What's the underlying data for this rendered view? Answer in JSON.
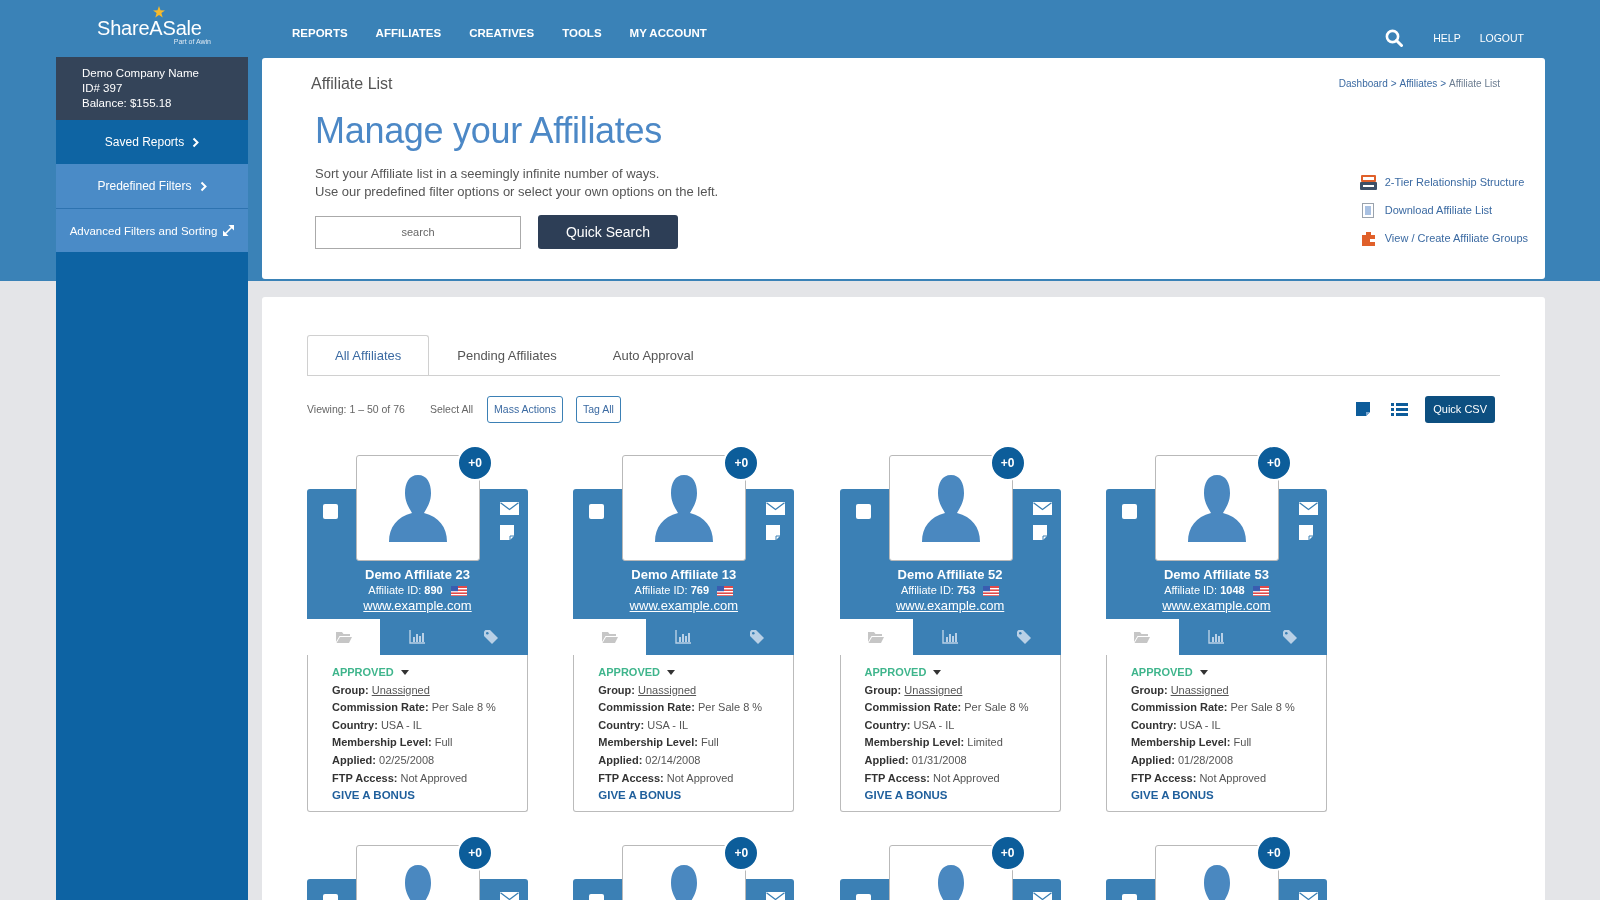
{
  "header": {
    "logo": {
      "name": "ShareASale",
      "tagline": "Part of Awin"
    },
    "nav": [
      {
        "label": "REPORTS"
      },
      {
        "label": "AFFILIATES"
      },
      {
        "label": "CREATIVES"
      },
      {
        "label": "TOOLS"
      },
      {
        "label": "MY ACCOUNT"
      }
    ],
    "links": [
      {
        "label": "HELP"
      },
      {
        "label": "LOGOUT"
      }
    ]
  },
  "sidebar": {
    "account": {
      "company": "Demo Company Name",
      "id": "ID# 397",
      "balance": "Balance: $155.18"
    },
    "items": [
      {
        "label": "Saved Reports",
        "kind": "report"
      },
      {
        "label": "Predefined Filters",
        "kind": "filter"
      },
      {
        "label": "Advanced Filters and Sorting",
        "kind": "advanced"
      }
    ]
  },
  "intro": {
    "title": "Affiliate List",
    "breadcrumb": [
      {
        "label": "Dashboard",
        "kind": "link"
      },
      {
        "label": ">",
        "kind": "separator"
      },
      {
        "label": "Affiliates",
        "kind": "link"
      },
      {
        "label": ">",
        "kind": "separator"
      },
      {
        "label": "Affiliate List",
        "kind": "current"
      }
    ],
    "heading": "Manage your Affiliates",
    "description": [
      "Sort your Affiliate list in a seemingly infinite number of ways.",
      "Use our predefined filter options or select your own options on the left."
    ],
    "search": {
      "placeholder": "search"
    },
    "search_button": "Quick Search",
    "quick_links": [
      {
        "label": "2-Tier Relationship Structure",
        "kind": "tray"
      },
      {
        "label": "Download Affiliate List",
        "kind": "document"
      },
      {
        "label": "View / Create Affiliate Groups",
        "kind": "puzzle"
      }
    ]
  },
  "affiliates": {
    "tabs": [
      {
        "label": "All Affiliates",
        "selected": true
      },
      {
        "label": "Pending Affiliates",
        "selected": false
      },
      {
        "label": "Auto Approval",
        "selected": false
      }
    ],
    "toolbar": {
      "viewing": "Viewing: 1 – 50 of 76",
      "select_all": "Select All",
      "buttons": [
        {
          "label": "Mass Actions"
        },
        {
          "label": "Tag All"
        }
      ],
      "views": [
        {
          "kind": "tiles"
        },
        {
          "kind": "list"
        }
      ],
      "csv_button": "Quick CSV"
    },
    "cards": [
      {
        "badge": "+0",
        "checked": false,
        "name": "Demo Affiliate 23",
        "id": "Affiliate ID: **890**",
        "website": "www.example.com",
        "tabs": [
          {
            "kind": "folder",
            "selected": true
          },
          {
            "kind": "chart",
            "selected": false
          },
          {
            "kind": "tag",
            "selected": false
          }
        ],
        "status": "APPROVED",
        "details": [
          {
            "label": "Group:",
            "value": "Unassigned",
            "kind": "link"
          },
          {
            "label": "Commission Rate:",
            "value": "Per Sale 8 %",
            "kind": "text"
          },
          {
            "label": "Country:",
            "value": "USA - IL",
            "kind": "text"
          },
          {
            "label": "Membership Level:",
            "value": "Full",
            "kind": "text"
          },
          {
            "label": "Applied:",
            "value": "02/25/2008",
            "kind": "text"
          },
          {
            "label": "FTP Access:",
            "value": "Not Approved",
            "kind": "text"
          }
        ],
        "bonus_link": "GIVE A BONUS"
      },
      {
        "badge": "+0",
        "checked": false,
        "name": "Demo Affiliate 13",
        "id": "Affiliate ID: **769**",
        "website": "www.example.com",
        "tabs": [
          {
            "kind": "folder",
            "selected": true
          },
          {
            "kind": "chart",
            "selected": false
          },
          {
            "kind": "tag",
            "selected": false
          }
        ],
        "status": "APPROVED",
        "details": [
          {
            "label": "Group:",
            "value": "Unassigned",
            "kind": "link"
          },
          {
            "label": "Commission Rate:",
            "value": "Per Sale 8 %",
            "kind": "text"
          },
          {
            "label": "Country:",
            "value": "USA - IL",
            "kind": "text"
          },
          {
            "label": "Membership Level:",
            "value": "Full",
            "kind": "text"
          },
          {
            "label": "Applied:",
            "value": "02/14/2008",
            "kind": "text"
          },
          {
            "label": "FTP Access:",
            "value": "Not Approved",
            "kind": "text"
          }
        ],
        "bonus_link": "GIVE A BONUS"
      },
      {
        "badge": "+0",
        "checked": false,
        "name": "Demo Affiliate 52",
        "id": "Affiliate ID: **753**",
        "website": "www.example.com",
        "tabs": [
          {
            "kind": "folder",
            "selected": true
          },
          {
            "kind": "chart",
            "selected": false
          },
          {
            "kind": "tag",
            "selected": false
          }
        ],
        "status": "APPROVED",
        "details": [
          {
            "label": "Group:",
            "value": "Unassigned",
            "kind": "link"
          },
          {
            "label": "Commission Rate:",
            "value": "Per Sale 8 %",
            "kind": "text"
          },
          {
            "label": "Country:",
            "value": "USA - IL",
            "kind": "text"
          },
          {
            "label": "Membership Level:",
            "value": "Limited",
            "kind": "text"
          },
          {
            "label": "Applied:",
            "value": "01/31/2008",
            "kind": "text"
          },
          {
            "label": "FTP Access:",
            "value": "Not Approved",
            "kind": "text"
          }
        ],
        "bonus_link": "GIVE A BONUS"
      },
      {
        "badge": "+0",
        "checked": false,
        "name": "Demo Affiliate 53",
        "id": "Affiliate ID: **1048**",
        "website": "www.example.com",
        "tabs": [
          {
            "kind": "folder",
            "selected": true
          },
          {
            "kind": "chart",
            "selected": false
          },
          {
            "kind": "tag",
            "selected": false
          }
        ],
        "status": "APPROVED",
        "details": [
          {
            "label": "Group:",
            "value": "Unassigned",
            "kind": "link"
          },
          {
            "label": "Commission Rate:",
            "value": "Per Sale 8 %",
            "kind": "text"
          },
          {
            "label": "Country:",
            "value": "USA - IL",
            "kind": "text"
          },
          {
            "label": "Membership Level:",
            "value": "Full",
            "kind": "text"
          },
          {
            "label": "Applied:",
            "value": "01/28/2008",
            "kind": "text"
          },
          {
            "label": "FTP Access:",
            "value": "Not Approved",
            "kind": "text"
          }
        ],
        "bonus_link": "GIVE A BONUS"
      },
      {
        "badge": "+0",
        "checked": false
      },
      {
        "badge": "+0",
        "checked": false
      },
      {
        "badge": "+0",
        "checked": false
      },
      {
        "badge": "+0",
        "checked": false
      }
    ]
  }
}
